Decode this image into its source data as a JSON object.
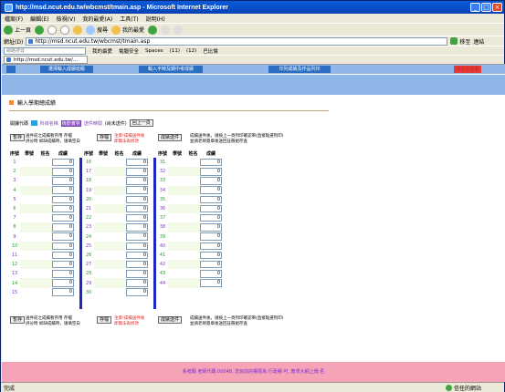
{
  "window": {
    "title": "http://msd.ncut.edu.tw/wbcmst/tmain.asp - Microsoft Internet Explorer"
  },
  "menu": [
    "檔案(F)",
    "編輯(E)",
    "檢視(V)",
    "我的最愛(A)",
    "工具(T)",
    "說明(H)"
  ],
  "toolbar": {
    "back": "上一頁",
    "search": "搜尋",
    "favorites": "我的最愛"
  },
  "address": {
    "label": "網址(D)",
    "url": "http://msd.ncut.edu.tw/wbcmst/tmain.asp",
    "go": "移至",
    "links": "連結"
  },
  "linksbar": {
    "search_placeholder": "網路搜尋",
    "fav": "我的最愛",
    "security": "電腦安全",
    "spaces": "Spaces",
    "mail": "(11)",
    "msn": "(12)",
    "yahoo": "巴比倫"
  },
  "tab": {
    "label": "http://msd.ncut.edu.tw/..."
  },
  "page": {
    "header": "輸入學期總成績",
    "nav": [
      "選擇輸入成績班級",
      "輸入平時及期中考成績",
      "印列成績及作品列印",
      "返回主畫面"
    ],
    "info": {
      "course_code_label": "開課代碼",
      "course_name_label": "科目名稱",
      "course_name": "機動實務",
      "time_label": "送件時間",
      "time_value": "(尚未送件)",
      "back_button": "回上一頁"
    },
    "controls_top": {
      "save_button": "暫存",
      "save_note1": "送件前之成績暫存用 存檔",
      "save_note2": "評分時 如缺成績時，請填空白",
      "save_button2": "存檔",
      "warn1": "注意!成績送件後",
      "warn2": "即無法再修改",
      "submit_button": "成績送件",
      "submit_note1": "成績送件後，請按上一頁列印確認單(直接點選列印)",
      "submit_note2": "並請老師簽章後送回註冊組存查"
    },
    "headers": {
      "no": "序號",
      "student_id": "學號",
      "name": "姓名",
      "score": "成績"
    },
    "columns": [
      {
        "rows": [
          {
            "no": "1",
            "score": "0"
          },
          {
            "no": "2",
            "score": "0"
          },
          {
            "no": "3",
            "score": "0"
          },
          {
            "no": "4",
            "score": "0"
          },
          {
            "no": "5",
            "score": "0"
          },
          {
            "no": "6",
            "score": "0"
          },
          {
            "no": "7",
            "score": "0"
          },
          {
            "no": "8",
            "score": "0"
          },
          {
            "no": "9",
            "score": "0"
          },
          {
            "no": "10",
            "score": "0"
          },
          {
            "no": "11",
            "score": "0"
          },
          {
            "no": "12",
            "score": "0"
          },
          {
            "no": "13",
            "score": "0"
          },
          {
            "no": "14",
            "score": "0"
          },
          {
            "no": "15",
            "score": "0"
          }
        ]
      },
      {
        "rows": [
          {
            "no": "16",
            "score": "0"
          },
          {
            "no": "17",
            "score": "0"
          },
          {
            "no": "18",
            "score": "0"
          },
          {
            "no": "19",
            "score": "0"
          },
          {
            "no": "20",
            "score": "0"
          },
          {
            "no": "21",
            "score": "0"
          },
          {
            "no": "22",
            "score": "0"
          },
          {
            "no": "23",
            "score": "0"
          },
          {
            "no": "24",
            "score": "0"
          },
          {
            "no": "25",
            "score": "0"
          },
          {
            "no": "26",
            "score": "0"
          },
          {
            "no": "27",
            "score": "0"
          },
          {
            "no": "28",
            "score": "0"
          },
          {
            "no": "29",
            "score": "0"
          },
          {
            "no": "30",
            "score": "0"
          }
        ]
      },
      {
        "rows": [
          {
            "no": "31",
            "score": "0"
          },
          {
            "no": "32",
            "score": "0"
          },
          {
            "no": "33",
            "score": "0"
          },
          {
            "no": "34",
            "score": "0"
          },
          {
            "no": "35",
            "score": "0"
          },
          {
            "no": "36",
            "score": "0"
          },
          {
            "no": "37",
            "score": "0"
          },
          {
            "no": "38",
            "score": "0"
          },
          {
            "no": "39",
            "score": "0"
          },
          {
            "no": "40",
            "score": "0"
          },
          {
            "no": "41",
            "score": "0"
          },
          {
            "no": "42",
            "score": "0"
          },
          {
            "no": "43",
            "score": "0"
          },
          {
            "no": "44",
            "score": "0"
          }
        ]
      }
    ],
    "footer": "系者願 老師代碼:00048, 您目前的權限為 行政權:可, 教學大網上傳:否",
    "status": {
      "left": "完成",
      "zone": "信任的網站"
    }
  }
}
